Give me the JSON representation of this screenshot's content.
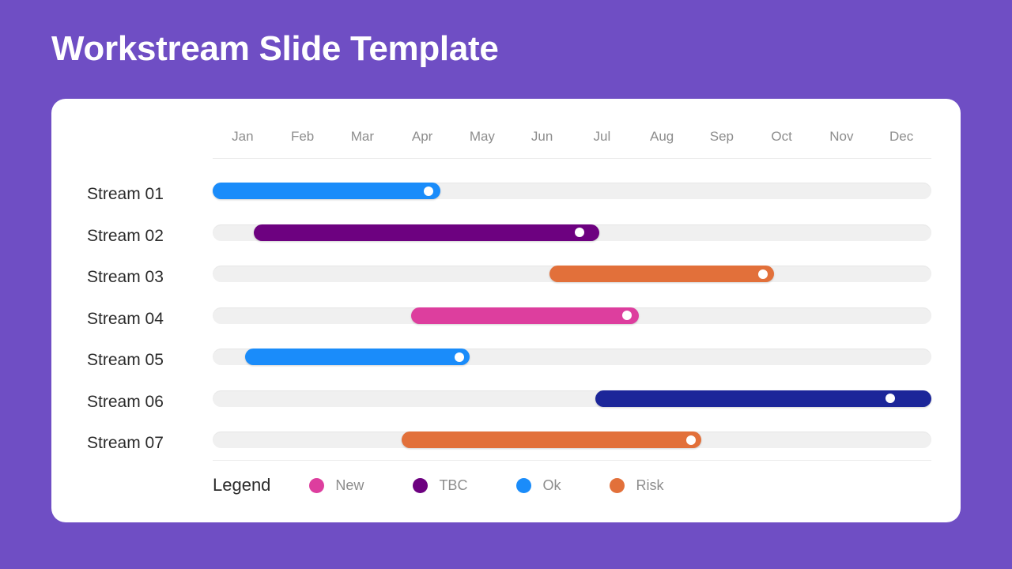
{
  "slide": {
    "title": "Workstream Slide Template",
    "background_color": "#6f4ec4",
    "card_color": "#ffffff"
  },
  "timeline": {
    "months": [
      "Jan",
      "Feb",
      "Mar",
      "Apr",
      "May",
      "Jun",
      "Jul",
      "Aug",
      "Sep",
      "Oct",
      "Nov",
      "Dec"
    ]
  },
  "legend": {
    "title": "Legend",
    "items": [
      {
        "label": "New",
        "color": "#dd3e9e"
      },
      {
        "label": "TBC",
        "color": "#6d0180"
      },
      {
        "label": "Ok",
        "color": "#1a8cfa"
      },
      {
        "label": "Risk",
        "color": "#e2703a"
      }
    ]
  },
  "chart_data": {
    "type": "bar",
    "title": "Workstream Slide Template",
    "xlabel": "",
    "ylabel": "",
    "categories": [
      "Stream 01",
      "Stream 02",
      "Stream 03",
      "Stream 04",
      "Stream 05",
      "Stream 06",
      "Stream 07"
    ],
    "x_axis": {
      "tick_labels": [
        "Jan",
        "Feb",
        "Mar",
        "Apr",
        "May",
        "Jun",
        "Jul",
        "Aug",
        "Sep",
        "Oct",
        "Nov",
        "Dec"
      ],
      "range_months": [
        1,
        12
      ],
      "grid": false
    },
    "legend_entries": [
      {
        "name": "New",
        "color": "#dd3e9e"
      },
      {
        "name": "TBC",
        "color": "#6d0180"
      },
      {
        "name": "Ok",
        "color": "#1a8cfa"
      },
      {
        "name": "Risk",
        "color": "#e2703a"
      }
    ],
    "track_color": "#f0f0f0",
    "bars": [
      {
        "label": "Stream 01",
        "status": "Ok",
        "color": "#1a8cfa",
        "start_pct": 0.0,
        "end_pct": 31.7,
        "start_month": "Jan",
        "end_month": "Apr",
        "marker_pct": 30.0
      },
      {
        "label": "Stream 02",
        "status": "TBC",
        "color": "#6d0180",
        "start_pct": 5.7,
        "end_pct": 53.8,
        "start_month": "Jan",
        "end_month": "Jul",
        "marker_pct": 51.0
      },
      {
        "label": "Stream 03",
        "status": "Risk",
        "color": "#e2703a",
        "start_pct": 46.9,
        "end_pct": 78.1,
        "start_month": "Jul",
        "end_month": "Oct",
        "marker_pct": 76.6
      },
      {
        "label": "Stream 04",
        "status": "New",
        "color": "#dd3e9e",
        "start_pct": 27.6,
        "end_pct": 59.3,
        "start_month": "Apr",
        "end_month": "Aug",
        "marker_pct": 57.6
      },
      {
        "label": "Stream 05",
        "status": "Ok",
        "color": "#1a8cfa",
        "start_pct": 4.5,
        "end_pct": 35.8,
        "start_month": "Jan",
        "end_month": "May",
        "marker_pct": 34.3
      },
      {
        "label": "Stream 06",
        "status": "TBC",
        "color": "#1c2699",
        "start_pct": 53.2,
        "end_pct": 100.0,
        "start_month": "Jul",
        "end_month": "Dec",
        "marker_pct": 94.3
      },
      {
        "label": "Stream 07",
        "status": "Risk",
        "color": "#e2703a",
        "start_pct": 26.3,
        "end_pct": 68.0,
        "start_month": "Apr",
        "end_month": "Sep",
        "marker_pct": 66.6
      }
    ]
  }
}
